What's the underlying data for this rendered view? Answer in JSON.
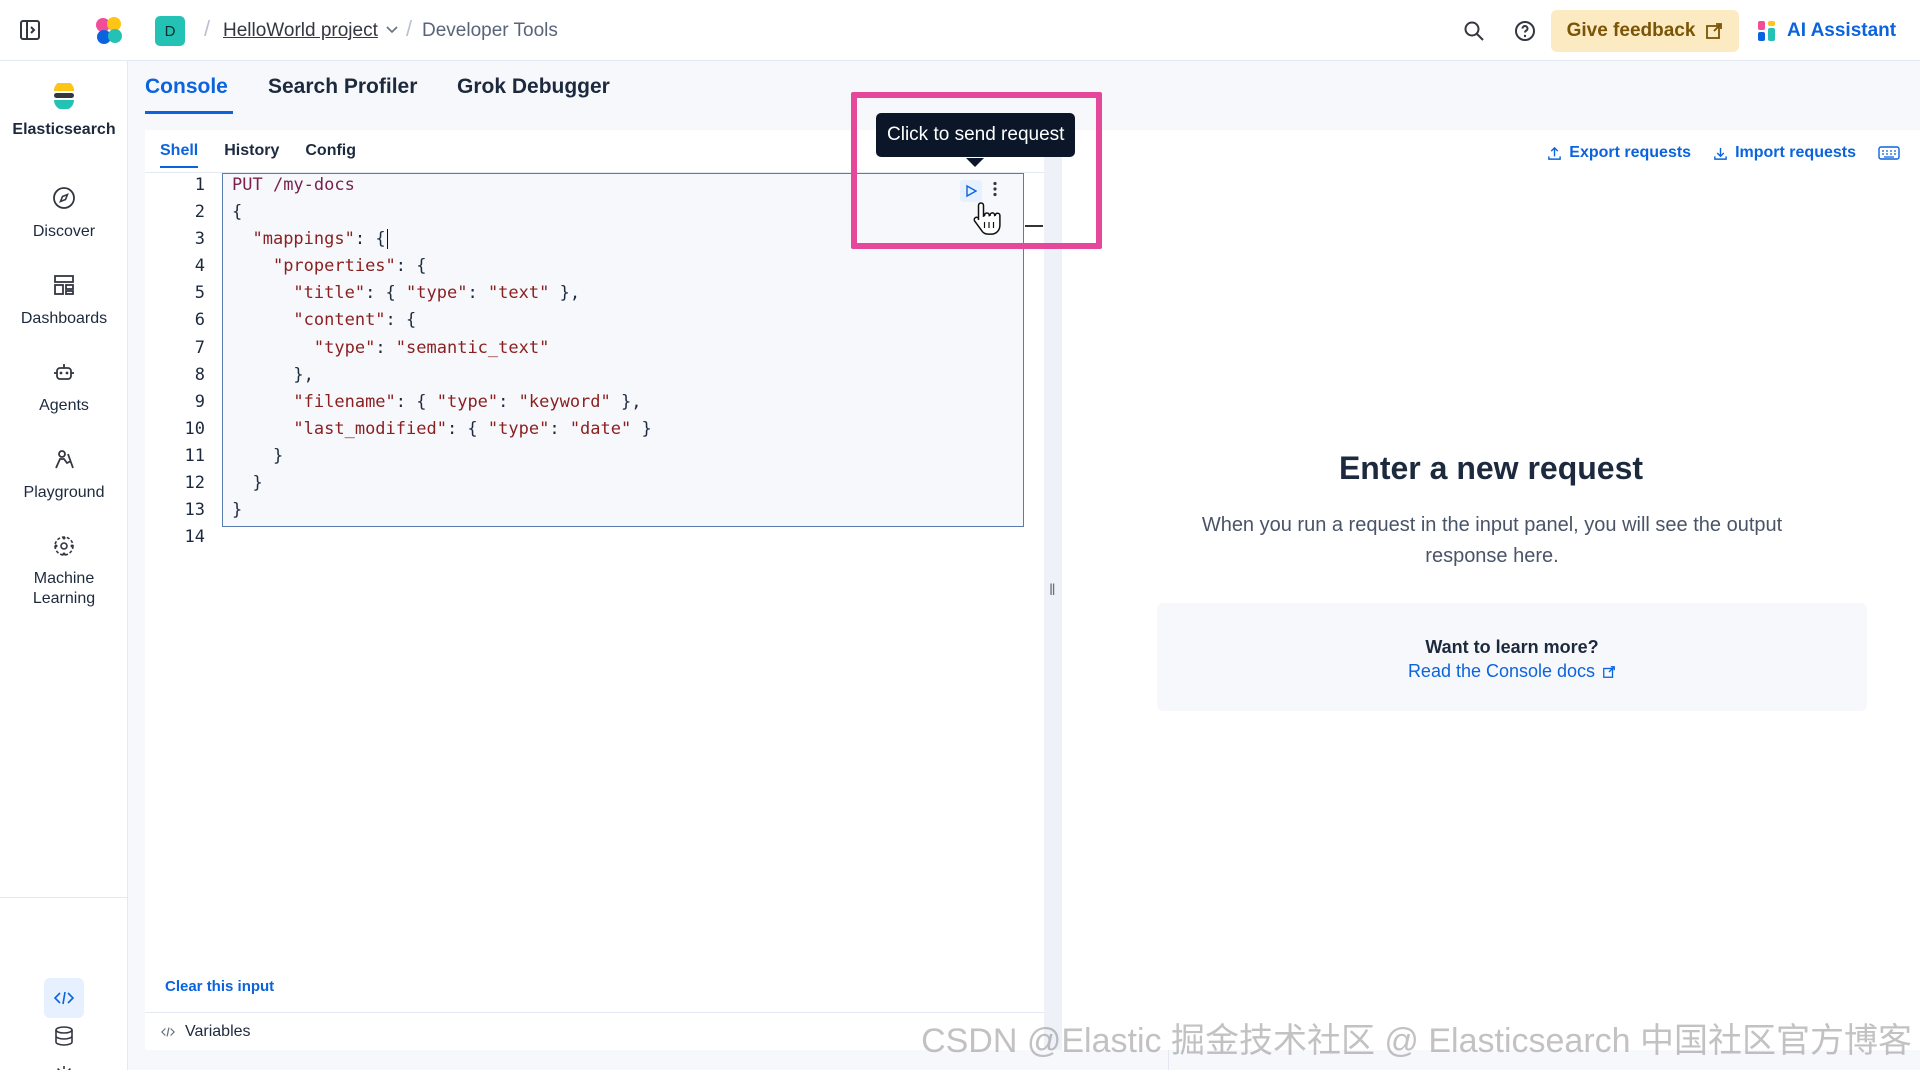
{
  "header": {
    "space_initial": "D",
    "project": "HelloWorld project",
    "breadcrumb": "Developer Tools",
    "feedback_label": "Give feedback",
    "ai_label": "AI Assistant"
  },
  "leftnav": {
    "items": [
      {
        "label": "Elasticsearch"
      },
      {
        "label": "Discover"
      },
      {
        "label": "Dashboards"
      },
      {
        "label": "Agents"
      },
      {
        "label": "Playground"
      },
      {
        "label": "Machine Learning"
      }
    ]
  },
  "devtools": {
    "tabs": [
      "Console",
      "Search Profiler",
      "Grok Debugger"
    ],
    "subtabs": [
      "Shell",
      "History",
      "Config"
    ]
  },
  "editor": {
    "line_numbers": [
      "1",
      "2",
      "3",
      "4",
      "5",
      "6",
      "7",
      "8",
      "9",
      "10",
      "11",
      "12",
      "13",
      "14"
    ],
    "clear_label": "Clear this input",
    "variables_label": "Variables"
  },
  "tooltip": {
    "text": "Click to send request"
  },
  "output": {
    "export_label": "Export requests",
    "import_label": "Import requests",
    "title": "Enter a new request",
    "description": "When you run a request in the input panel, you will see the output response here.",
    "learn_title": "Want to learn more?",
    "learn_link": "Read the Console docs"
  },
  "watermark": "CSDN @Elastic 掘金技术社区 @ Elasticsearch 中国社区官方博客",
  "colors": {
    "accent": "#0b64dd",
    "highlight": "#e5479a",
    "feedback_bg": "#fcebc2"
  }
}
